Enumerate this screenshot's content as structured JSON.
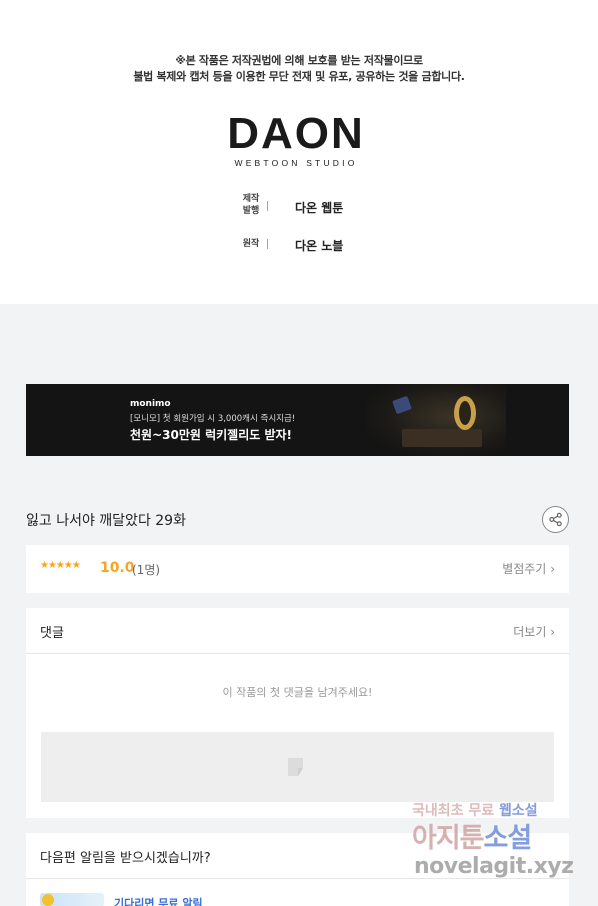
{
  "copyright_notice": {
    "line1": "※본 작품은 저작권법에 의해 보호를 받는 저작물이므로",
    "line2": "불법 복제와 캡처 등을 이용한 무단 전재 및 유포, 공유하는 것을 금합니다."
  },
  "studio_logo": {
    "name": "DAON",
    "subtitle": "WEBTOON STUDIO"
  },
  "credits": [
    {
      "label_line1": "제작",
      "label_line2": "발행",
      "value": "다온 웹툰"
    },
    {
      "label_line1": "원작",
      "label_line2": "",
      "value": "다온 노블"
    }
  ],
  "ad_banner": {
    "brand": "monimo",
    "line1": "[모니모] 첫 회원가입 시 3,000캐시 즉시지급!",
    "line2": "천원~30만원 럭키젤리도 받자!"
  },
  "episode": {
    "title": "잃고 나서야 깨달았다 29화"
  },
  "rating": {
    "stars": "★★★★★",
    "score": "10.0",
    "count": "(1명)",
    "rate_label": "별점주기"
  },
  "comments": {
    "title": "댓글",
    "more_label": "더보기",
    "empty_message": "이 작품의 첫 댓글을 남겨주세요!"
  },
  "next_alert": {
    "question": "다음편 알림을 받으시겠습니까?",
    "item_label": "기다리면 무료 알림"
  },
  "watermark": {
    "line1_a": "국내최초 무료",
    "line1_b": "웹소설",
    "line2_a": "아지툰",
    "line2_b": "소설",
    "line3": "novelagit.xyz"
  },
  "colors": {
    "accent_rating": "#f5a623",
    "credit_bar": "#c8a63a",
    "link_blue": "#3a6fd8",
    "page_bg": "#f2f3f5"
  }
}
